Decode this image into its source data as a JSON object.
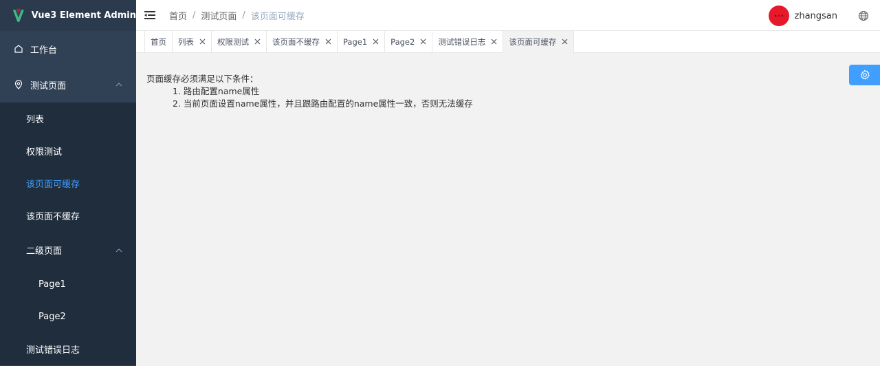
{
  "app": {
    "title": "Vue3 Element Admin"
  },
  "sidebar": {
    "items": [
      {
        "label": "工作台",
        "icon": "house-icon"
      },
      {
        "label": "测试页面",
        "icon": "location-icon"
      }
    ],
    "submenu": [
      {
        "label": "列表"
      },
      {
        "label": "权限测试"
      },
      {
        "label": "该页面可缓存",
        "active": true
      },
      {
        "label": "该页面不缓存"
      },
      {
        "label": "二级页面"
      },
      {
        "label": "Page1"
      },
      {
        "label": "Page2"
      },
      {
        "label": "测试错误日志"
      }
    ]
  },
  "header": {
    "breadcrumb": [
      "首页",
      "测试页面",
      "该页面可缓存"
    ],
    "separator": "/",
    "username": "zhangsan"
  },
  "tags": [
    {
      "label": "首页",
      "closable": false
    },
    {
      "label": "列表",
      "closable": true
    },
    {
      "label": "权限测试",
      "closable": true
    },
    {
      "label": "该页面不缓存",
      "closable": true
    },
    {
      "label": "Page1",
      "closable": true
    },
    {
      "label": "Page2",
      "closable": true
    },
    {
      "label": "测试错误日志",
      "closable": true
    },
    {
      "label": "该页面可缓存",
      "closable": true,
      "active": true
    }
  ],
  "main": {
    "heading": "页面缓存必须满足以下条件：",
    "conditions": [
      "1. 路由配置name属性",
      "2. 当前页面设置name属性，并且跟路由配置的name属性一致，否则无法缓存"
    ]
  },
  "colors": {
    "sidebar_bg": "#304156",
    "submenu_bg": "#1f2d3d",
    "accent": "#409eff",
    "avatar": "#e6192b"
  }
}
